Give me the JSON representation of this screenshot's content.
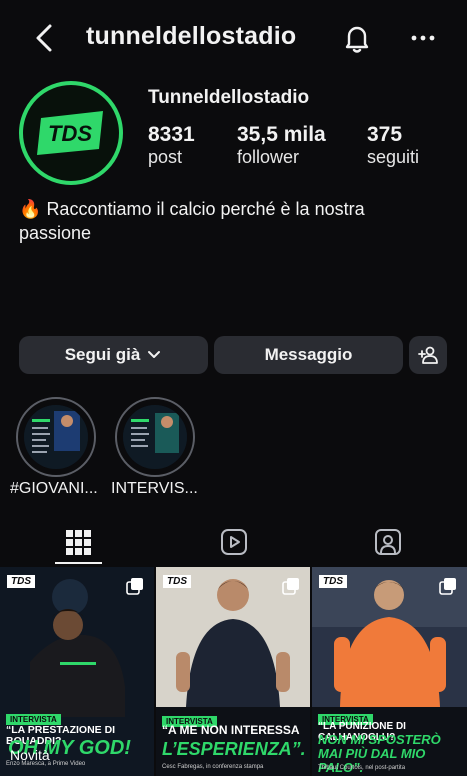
{
  "header": {
    "title": "tunneldellostadio"
  },
  "profile": {
    "display_name": "Tunneldellostadio",
    "avatar_text": "TDS",
    "stats": [
      {
        "value": "8331",
        "label": "post"
      },
      {
        "value": "35,5 mila",
        "label": "follower"
      },
      {
        "value": "375",
        "label": "seguiti"
      }
    ],
    "bio_emoji": "🔥",
    "bio": "Raccontiamo il calcio perché è la nostra passione"
  },
  "actions": {
    "follow_label": "Segui già",
    "message_label": "Messaggio"
  },
  "highlights": [
    {
      "label": "#GIOVANI..."
    },
    {
      "label": "INTERVIS..."
    }
  ],
  "tabs": [
    "grid-icon",
    "reels-icon",
    "tagged-icon"
  ],
  "posts": [
    {
      "badge": "TDS",
      "tag": "INTERVISTA",
      "quote_small": "“LA PRESTAZIONE DI BOUADDI?",
      "quote_big": "OH MY GOD!",
      "caption": "Enzo Maresca, a Prime Video",
      "overlay": "Novità"
    },
    {
      "badge": "TDS",
      "tag": "INTERVISTA",
      "quote_small": "“A ME NON INTERESSA",
      "quote_big": "L’ESPERIENZA”.",
      "caption": "Cesc Fabregas, in conferenza stampa"
    },
    {
      "badge": "TDS",
      "tag": "INTERVISTA",
      "quote_small": "“LA PUNIZIONE DI CALHANOGLU?",
      "quote_big": "NON MI SPOSTERÒ MAI PIÙ DAL MIO PALO”.",
      "caption": "Thibaut Courtois, nel post-partita"
    }
  ],
  "colors": {
    "accent": "#2fd86a",
    "background": "#0b0b0d",
    "button": "#2a2c32"
  }
}
